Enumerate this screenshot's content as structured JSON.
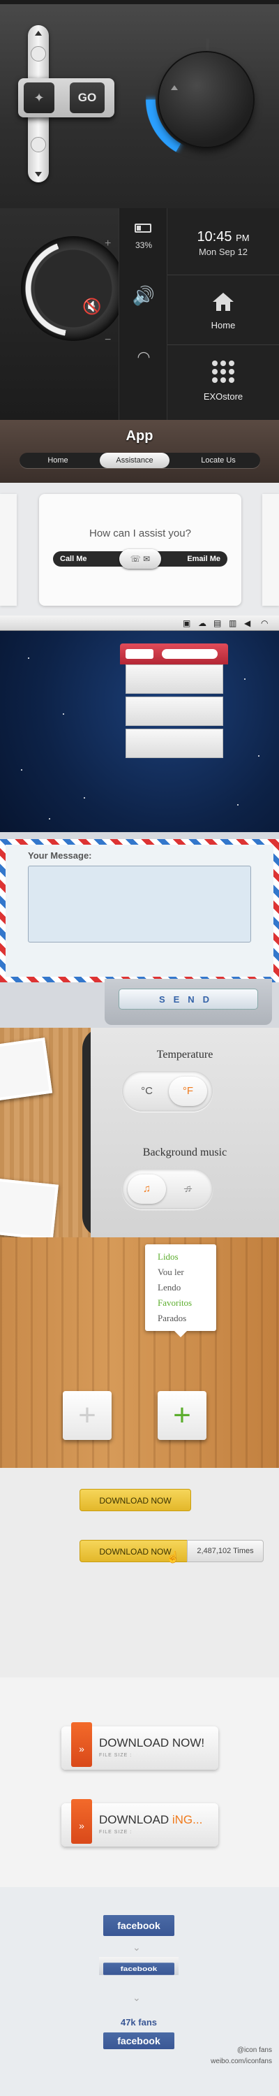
{
  "controls": {
    "go_label": "GO",
    "accent_color": "#2ba0ff"
  },
  "phone": {
    "battery_pct": "33%",
    "time": "10:45",
    "ampm": "PM",
    "date": "Mon Sep 12",
    "home_label": "Home",
    "exo_label": "EXOstore",
    "plus": "+",
    "minus": "−",
    "volume_level": 0.4
  },
  "app": {
    "title": "App",
    "nav": [
      "Home",
      "Assistance",
      "Locate Us"
    ],
    "active_tab": "Assistance"
  },
  "assist": {
    "question": "How can I assist you?",
    "call_label": "Call Me",
    "email_label": "Email Me"
  },
  "message": {
    "label": "Your Message:",
    "send_label": "SEND"
  },
  "settings": {
    "temperature_title": "Temperature",
    "celsius": "°C",
    "fahrenheit": "°F",
    "music_title": "Background music",
    "music_on": "♫",
    "music_off": "♫"
  },
  "reading_menu": {
    "items": [
      "Lidos",
      "Vou ler",
      "Lendo",
      "Favoritos",
      "Parados"
    ],
    "item_colors": [
      "#5cae2e",
      "#555555",
      "#555555",
      "#5cae2e",
      "#555555"
    ],
    "plus_symbol": "+"
  },
  "downloads": {
    "button_label": "DOWNLOAD NOW",
    "count_text": "2,487,102 Times",
    "big_label": "DOWNLOAD NOW!",
    "big_progress_prefix": "DOWNLOAD ",
    "big_progress_hl": "iNG...",
    "file_size": "FILE SIZE :"
  },
  "facebook": {
    "label": "facebook",
    "fans": "47k fans",
    "credit1": "@icon fans",
    "credit2": "weibo.com/iconfans"
  }
}
